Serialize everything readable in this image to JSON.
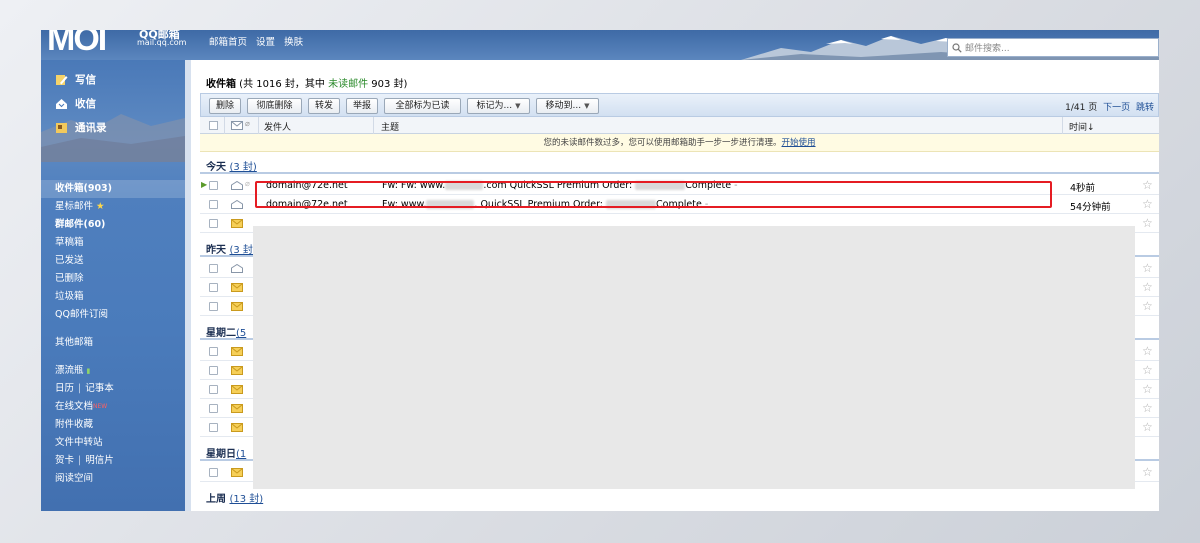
{
  "header": {
    "logo_big": "MOI",
    "logo_name": "QQ邮箱",
    "logo_domain": "mail.qq.com",
    "nav": [
      "邮箱首页",
      "设置",
      "换肤"
    ],
    "search_placeholder": "邮件搜索..."
  },
  "sidebar": {
    "write": "写信",
    "receive": "收信",
    "contacts": "通讯录",
    "folders": [
      {
        "label": "收件箱(903)",
        "style": "active"
      },
      {
        "label": "星标邮件",
        "style": "star"
      },
      {
        "label": "群邮件(60)",
        "style": "bold"
      },
      {
        "label": "草稿箱",
        "style": "normal"
      },
      {
        "label": "已发送",
        "style": "normal"
      },
      {
        "label": "已删除",
        "style": "normal"
      },
      {
        "label": "垃圾箱",
        "style": "normal"
      },
      {
        "label": "QQ邮件订阅",
        "style": "normal"
      }
    ],
    "other": "其他邮箱",
    "drift": "漂流瓶",
    "calendar": "日历",
    "notes": "记事本",
    "docs": "在线文档",
    "docs_badge": "NEW",
    "attachments": "附件收藏",
    "transfer": "文件中转站",
    "card": "贺卡",
    "postcard": "明信片",
    "reading": "阅读空间"
  },
  "inbox": {
    "title_prefix": "收件箱",
    "title_count": " (共 1016 封，其中 ",
    "title_unread": "未读邮件",
    "title_suffix": " 903 封)"
  },
  "toolbar": {
    "buttons": [
      "删除",
      "彻底删除",
      "转发",
      "举报",
      "全部标为已读",
      "标记为...",
      "移动到..."
    ],
    "pager": "1/41 页",
    "next": "下一页",
    "jump": "跳转"
  },
  "columns": {
    "sender": "发件人",
    "subject": "主题",
    "time": "时间↓"
  },
  "notice": {
    "text": "您的未读邮件数过多，您可以使用邮箱助手一步一步进行清理。",
    "link": "开始使用"
  },
  "groups": [
    {
      "label": "今天",
      "count": "(3 封)"
    },
    {
      "label": "昨天",
      "count": "(3 封)"
    },
    {
      "label": "星期二",
      "count": "(5"
    },
    {
      "label": "星期日",
      "count": "(1"
    },
    {
      "label": "上周",
      "count": "(13 封)"
    }
  ],
  "emails": [
    {
      "sender": "domain@72e.net",
      "subject_a": "Fw: Fw: www.",
      "subject_b": ".com QuickSSL Premium Order: ",
      "subject_c": "Complete",
      "dash": " -",
      "time": "4秒前"
    },
    {
      "sender": "domain@72e.net",
      "subject_a": "Fw: www.",
      "subject_b": ". QuickSSL Premium Order: ",
      "subject_c": "Complete",
      "dash": " -",
      "time": "54分钟前"
    }
  ],
  "colors": {
    "highlight": "#e51c23",
    "unread": "#2a8a2a",
    "link": "#1f4f96"
  }
}
